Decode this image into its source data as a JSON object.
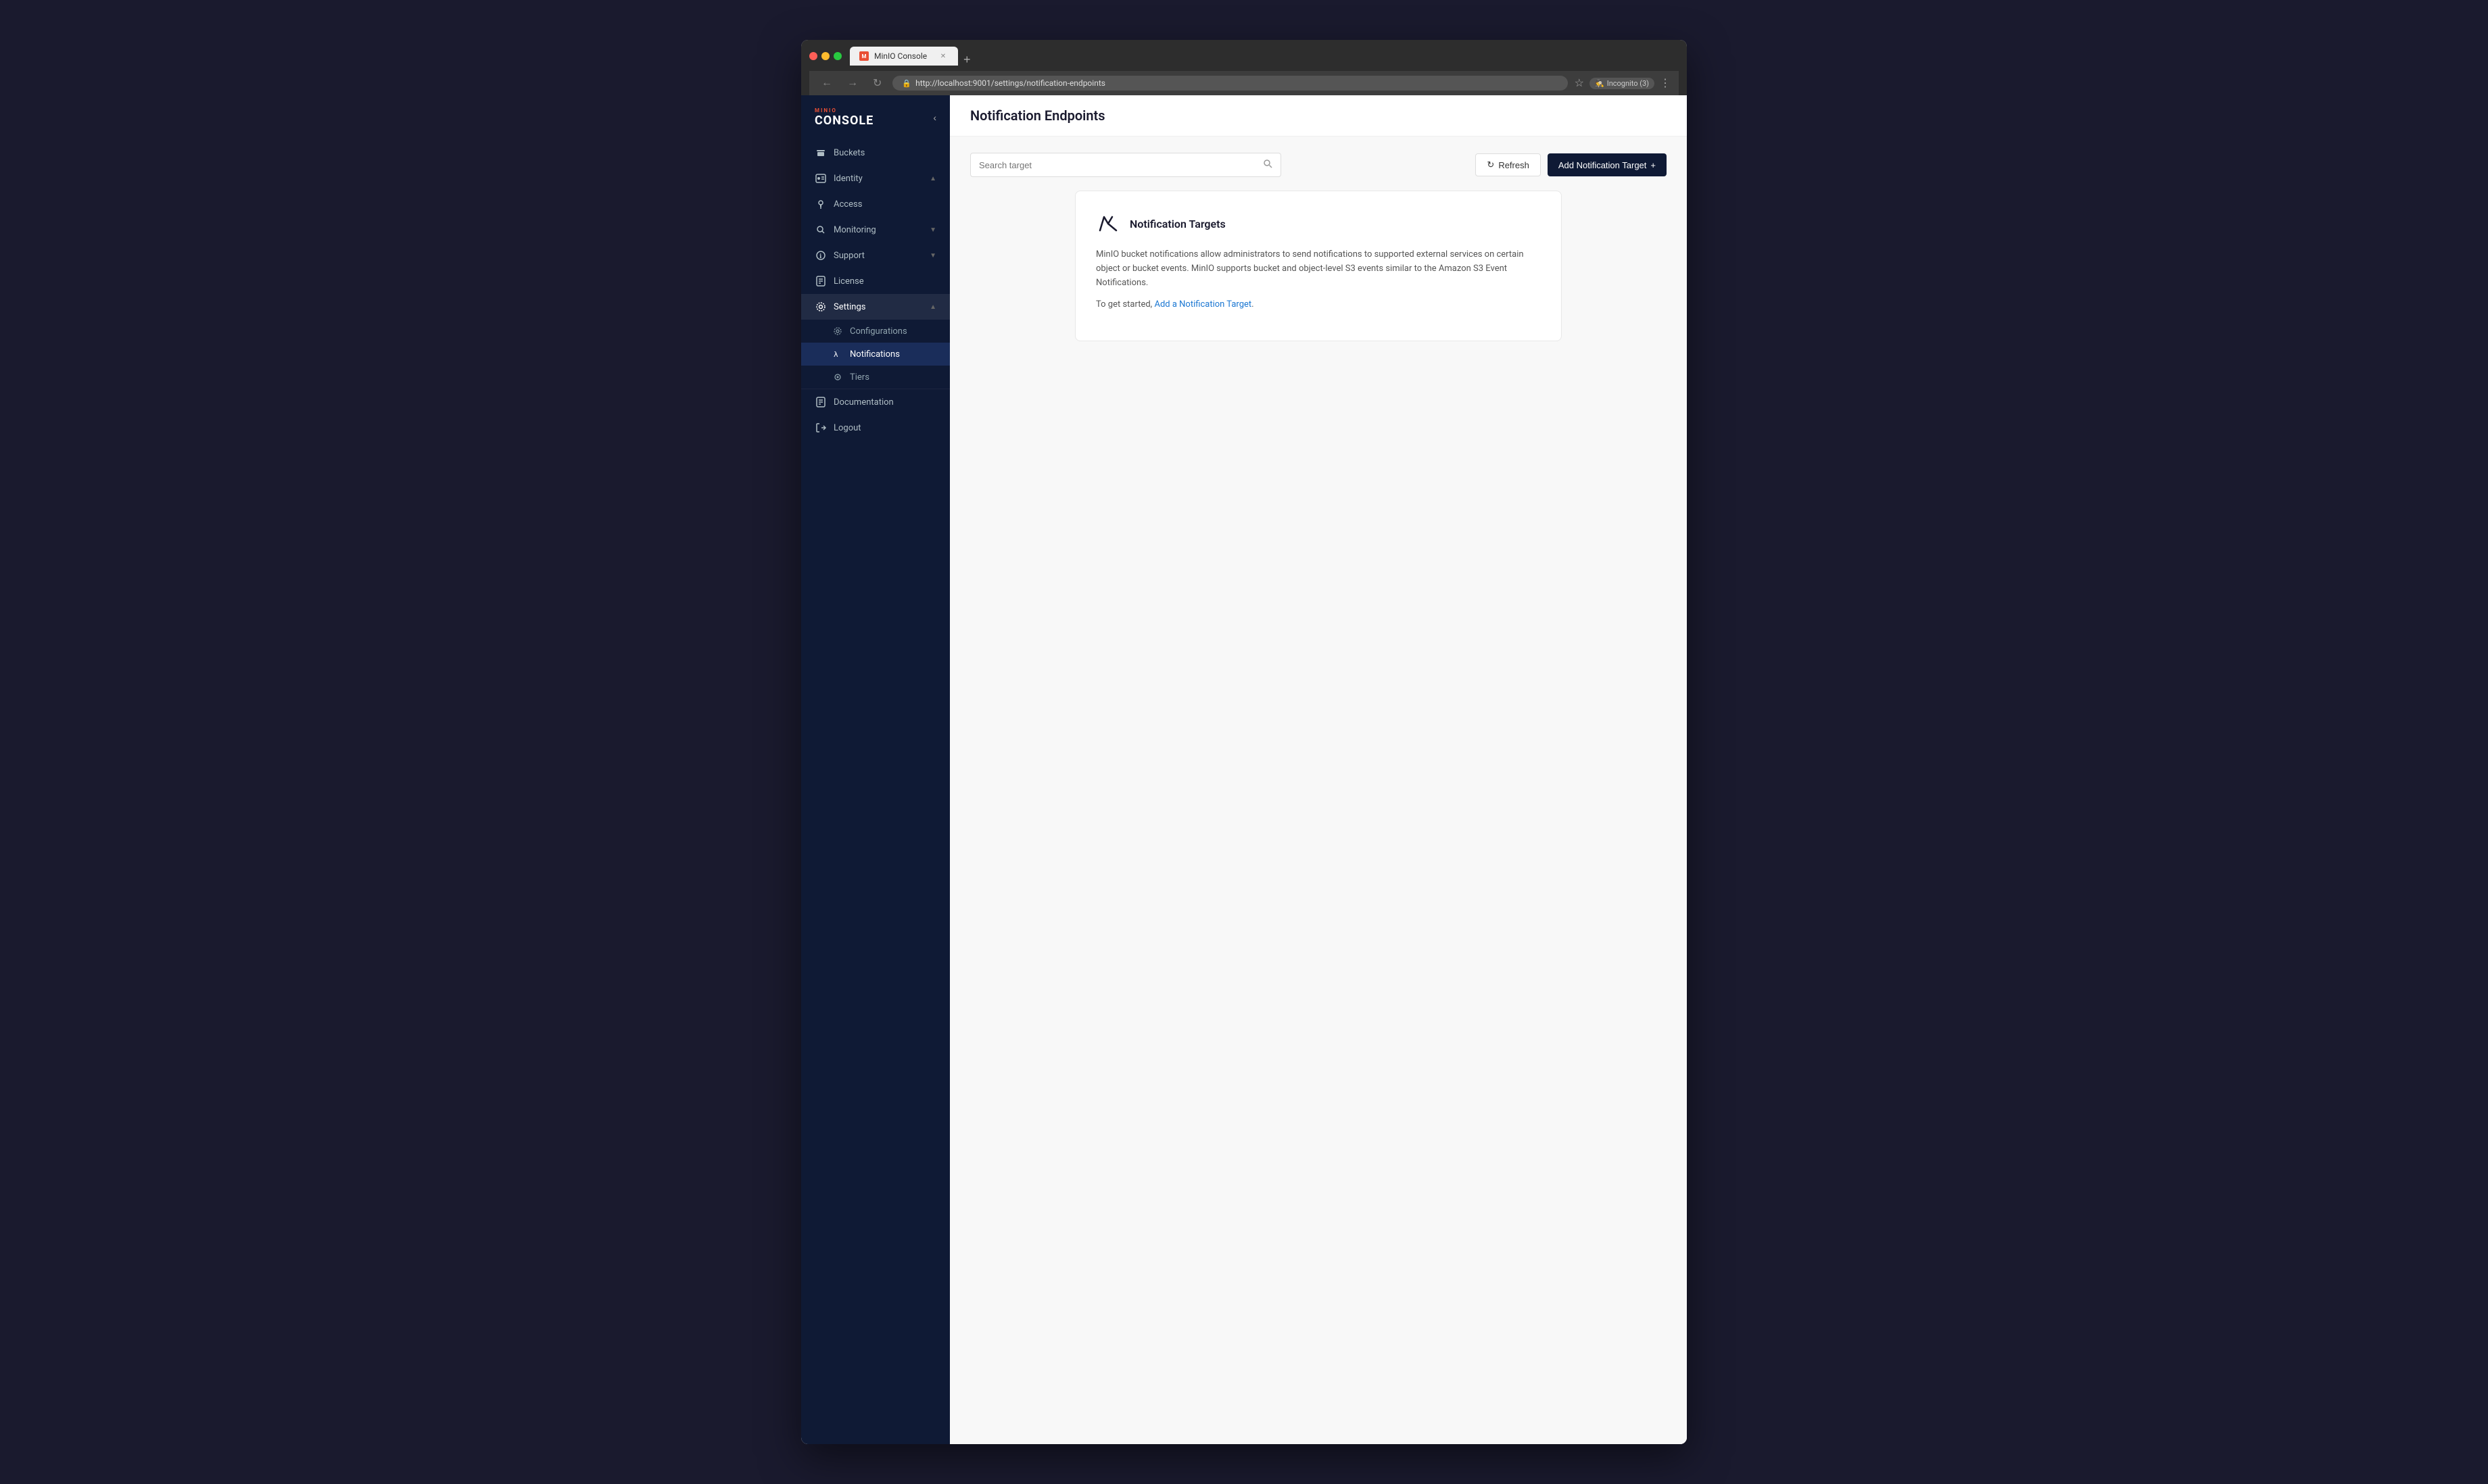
{
  "browser": {
    "url": "http://localhost:9001/settings/notification-endpoints",
    "tab_title": "MinIO Console",
    "incognito_label": "Incognito (3)"
  },
  "sidebar": {
    "logo_mini": "MINIO",
    "logo_console": "CONSOLE",
    "nav_items": [
      {
        "id": "buckets",
        "label": "Buckets",
        "icon": "☰",
        "has_children": false
      },
      {
        "id": "identity",
        "label": "Identity",
        "icon": "🪪",
        "has_children": true,
        "expanded": true
      },
      {
        "id": "access",
        "label": "Access",
        "icon": "🔒",
        "has_children": false
      },
      {
        "id": "monitoring",
        "label": "Monitoring",
        "icon": "🔍",
        "has_children": true,
        "expanded": false
      },
      {
        "id": "support",
        "label": "Support",
        "icon": "ℹ",
        "has_children": true,
        "expanded": false
      },
      {
        "id": "license",
        "label": "License",
        "icon": "📋",
        "has_children": false
      },
      {
        "id": "settings",
        "label": "Settings",
        "icon": "⚙",
        "has_children": true,
        "expanded": true
      }
    ],
    "settings_sub_items": [
      {
        "id": "configurations",
        "label": "Configurations",
        "icon": "⚙",
        "active": false
      },
      {
        "id": "notifications",
        "label": "Notifications",
        "icon": "λ",
        "active": true
      },
      {
        "id": "tiers",
        "label": "Tiers",
        "icon": "◎",
        "active": false
      }
    ],
    "bottom_items": [
      {
        "id": "documentation",
        "label": "Documentation",
        "icon": "📄"
      },
      {
        "id": "logout",
        "label": "Logout",
        "icon": "⬡"
      }
    ]
  },
  "page": {
    "title": "Notification Endpoints",
    "search_placeholder": "Search target",
    "refresh_label": "Refresh",
    "add_button_label": "Add Notification Target",
    "refresh_icon": "↻",
    "add_icon": "+"
  },
  "info_card": {
    "title": "Notification Targets",
    "lambda_symbol": "λ",
    "paragraph1": "MinIO bucket notifications allow administrators to send notifications to supported external services on certain object or bucket events. MinIO supports bucket and object-level S3 events similar to the Amazon S3 Event Notifications.",
    "paragraph2_prefix": "To get started,",
    "link_text": "Add a Notification Target",
    "paragraph2_suffix": "."
  }
}
